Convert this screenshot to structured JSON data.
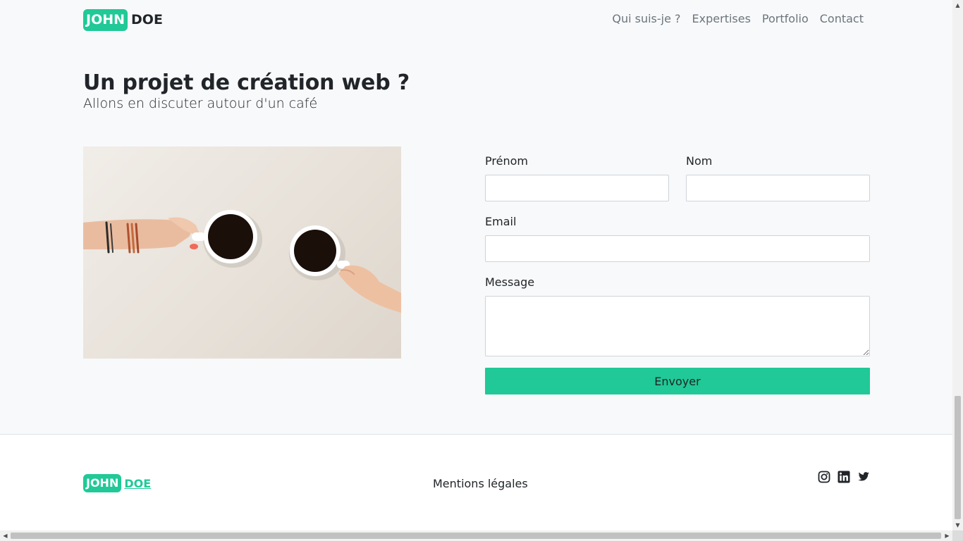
{
  "navbar": {
    "brand_box": "JOHN",
    "brand_rest": "DOE",
    "links": [
      "Qui suis-je ?",
      "Expertises",
      "Portfolio",
      "Contact"
    ]
  },
  "contact": {
    "title": "Un projet de création web ?",
    "subtitle": "Allons en discuter autour d'un café",
    "form": {
      "firstname_label": "Prénom",
      "firstname_value": "",
      "lastname_label": "Nom",
      "lastname_value": "",
      "email_label": "Email",
      "email_value": "",
      "message_label": "Message",
      "message_value": "",
      "submit_label": "Envoyer"
    }
  },
  "footer": {
    "brand_box": "JOHN",
    "brand_rest": "DOE",
    "legal_link": "Mentions légales",
    "social_icons": [
      "instagram-icon",
      "linkedin-icon",
      "twitter-icon"
    ]
  },
  "colors": {
    "accent": "#20c997",
    "background": "#f8f9fa",
    "text": "#212529",
    "nav_text": "#6c757d"
  }
}
